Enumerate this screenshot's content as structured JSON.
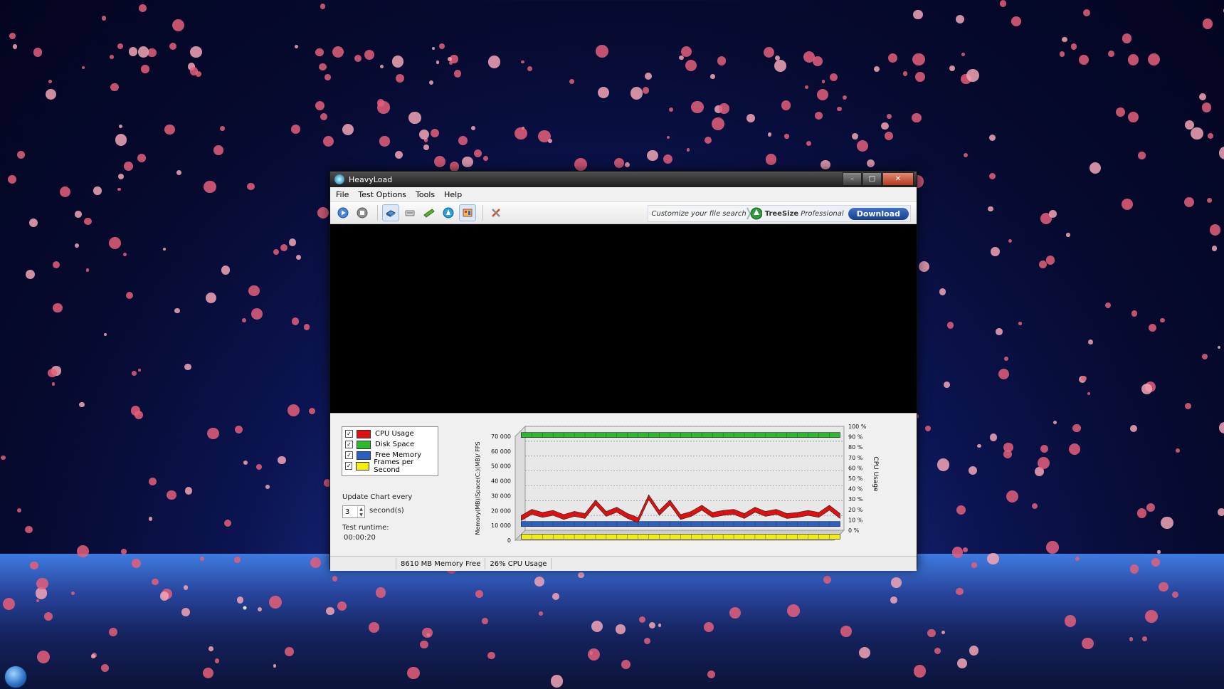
{
  "window": {
    "title": "HeavyLoad",
    "buttons": {
      "minimize": "–",
      "maximize": "□",
      "close": "✕"
    }
  },
  "menu": [
    "File",
    "Test Options",
    "Tools",
    "Help"
  ],
  "toolbar": {
    "icons": [
      "start-icon",
      "stop-icon",
      "cpu-icon",
      "disk-icon",
      "memory-icon",
      "gpu-icon",
      "treesize-icon",
      "tools-icon"
    ]
  },
  "ad": {
    "tagline": "Customize your file search",
    "brand": "TreeSize",
    "edition": "Professional",
    "download_label": "Download"
  },
  "legend": [
    {
      "label": "CPU Usage",
      "color": "#e01010",
      "checked": true
    },
    {
      "label": "Disk Space",
      "color": "#2fb82f",
      "checked": true
    },
    {
      "label": "Free Memory",
      "color": "#2a5fc4",
      "checked": true
    },
    {
      "label": "Frames per Second",
      "color": "#f2ef10",
      "checked": true
    }
  ],
  "update": {
    "label": "Update Chart every",
    "value": "3",
    "unit": "second(s)"
  },
  "runtime": {
    "label": "Test runtime:",
    "value": "00:00:20"
  },
  "status": {
    "memory": "8610 MB Memory Free",
    "cpu": "26% CPU Usage"
  },
  "chart_data": {
    "type": "line",
    "left_axis_label": "Memory(MB)/Space(C:)(MB)/ FPS",
    "right_axis_label": "CPU Usage",
    "left_ticks": [
      "70 000",
      "60 000",
      "50 000",
      "40 000",
      "30 000",
      "20 000",
      "10 000",
      "0"
    ],
    "right_ticks": [
      "100 %",
      "90 %",
      "80 %",
      "70 %",
      "60 %",
      "50 %",
      "40 %",
      "30 %",
      "20 %",
      "10 %",
      "0 %"
    ],
    "left_ylim": [
      0,
      70000
    ],
    "right_ylim": [
      0,
      100
    ],
    "grid": true,
    "series": [
      {
        "name": "Disk Space",
        "color": "#2fb82f",
        "values": [
          68500,
          68500,
          68500,
          68500,
          68500,
          68500,
          68500,
          68500,
          68500,
          68500,
          68500,
          68500,
          68500,
          68500,
          68500,
          68500,
          68500,
          68500,
          68500,
          68500,
          68500,
          68500,
          68500,
          68500,
          68500,
          68500,
          68500,
          68500,
          68500,
          68500,
          68500
        ]
      },
      {
        "name": "Free Memory",
        "color": "#2a5fc4",
        "values": [
          8610,
          8610,
          8610,
          8610,
          8610,
          8610,
          8610,
          8610,
          8610,
          8610,
          8610,
          8610,
          8610,
          8610,
          8610,
          8610,
          8610,
          8610,
          8610,
          8610,
          8610,
          8610,
          8610,
          8610,
          8610,
          8610,
          8610,
          8610,
          8610,
          8610,
          8610
        ]
      },
      {
        "name": "Frames per Second",
        "color": "#f2ef10",
        "values": [
          0,
          0,
          0,
          0,
          0,
          0,
          0,
          0,
          0,
          0,
          0,
          0,
          0,
          0,
          0,
          0,
          0,
          0,
          0,
          0,
          0,
          0,
          0,
          0,
          0,
          0,
          0,
          0,
          0,
          0,
          0
        ]
      },
      {
        "name": "CPU Usage",
        "color": "#e01010",
        "values": [
          18,
          24,
          21,
          23,
          19,
          22,
          20,
          33,
          22,
          26,
          20,
          16,
          38,
          23,
          33,
          19,
          22,
          28,
          21,
          23,
          24,
          20,
          26,
          22,
          24,
          20,
          21,
          23,
          21,
          28,
          20
        ]
      }
    ]
  }
}
